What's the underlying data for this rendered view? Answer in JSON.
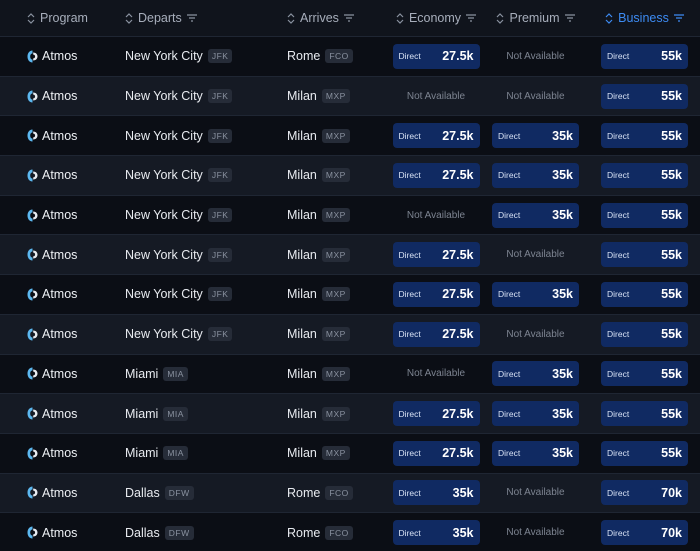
{
  "header": {
    "program": "Program",
    "departs": "Departs",
    "arrives": "Arrives",
    "economy": "Economy",
    "premium": "Premium",
    "business": "Business"
  },
  "labels": {
    "direct": "Direct",
    "not_available": "Not Available"
  },
  "colors": {
    "accent": "#3d8bf2",
    "pill": "#102a62",
    "background": "#0d1017"
  },
  "rows": [
    {
      "program": "Atmos",
      "dep_city": "New York City",
      "dep_code": "JFK",
      "arr_city": "Rome",
      "arr_code": "FCO",
      "economy": "27.5k",
      "premium": null,
      "business": "55k"
    },
    {
      "program": "Atmos",
      "dep_city": "New York City",
      "dep_code": "JFK",
      "arr_city": "Milan",
      "arr_code": "MXP",
      "economy": null,
      "premium": null,
      "business": "55k"
    },
    {
      "program": "Atmos",
      "dep_city": "New York City",
      "dep_code": "JFK",
      "arr_city": "Milan",
      "arr_code": "MXP",
      "economy": "27.5k",
      "premium": "35k",
      "business": "55k"
    },
    {
      "program": "Atmos",
      "dep_city": "New York City",
      "dep_code": "JFK",
      "arr_city": "Milan",
      "arr_code": "MXP",
      "economy": "27.5k",
      "premium": "35k",
      "business": "55k"
    },
    {
      "program": "Atmos",
      "dep_city": "New York City",
      "dep_code": "JFK",
      "arr_city": "Milan",
      "arr_code": "MXP",
      "economy": null,
      "premium": "35k",
      "business": "55k"
    },
    {
      "program": "Atmos",
      "dep_city": "New York City",
      "dep_code": "JFK",
      "arr_city": "Milan",
      "arr_code": "MXP",
      "economy": "27.5k",
      "premium": null,
      "business": "55k"
    },
    {
      "program": "Atmos",
      "dep_city": "New York City",
      "dep_code": "JFK",
      "arr_city": "Milan",
      "arr_code": "MXP",
      "economy": "27.5k",
      "premium": "35k",
      "business": "55k"
    },
    {
      "program": "Atmos",
      "dep_city": "New York City",
      "dep_code": "JFK",
      "arr_city": "Milan",
      "arr_code": "MXP",
      "economy": "27.5k",
      "premium": null,
      "business": "55k"
    },
    {
      "program": "Atmos",
      "dep_city": "Miami",
      "dep_code": "MIA",
      "arr_city": "Milan",
      "arr_code": "MXP",
      "economy": null,
      "premium": "35k",
      "business": "55k"
    },
    {
      "program": "Atmos",
      "dep_city": "Miami",
      "dep_code": "MIA",
      "arr_city": "Milan",
      "arr_code": "MXP",
      "economy": "27.5k",
      "premium": "35k",
      "business": "55k"
    },
    {
      "program": "Atmos",
      "dep_city": "Miami",
      "dep_code": "MIA",
      "arr_city": "Milan",
      "arr_code": "MXP",
      "economy": "27.5k",
      "premium": "35k",
      "business": "55k"
    },
    {
      "program": "Atmos",
      "dep_city": "Dallas",
      "dep_code": "DFW",
      "arr_city": "Rome",
      "arr_code": "FCO",
      "economy": "35k",
      "premium": null,
      "business": "70k"
    },
    {
      "program": "Atmos",
      "dep_city": "Dallas",
      "dep_code": "DFW",
      "arr_city": "Rome",
      "arr_code": "FCO",
      "economy": "35k",
      "premium": null,
      "business": "70k"
    }
  ]
}
